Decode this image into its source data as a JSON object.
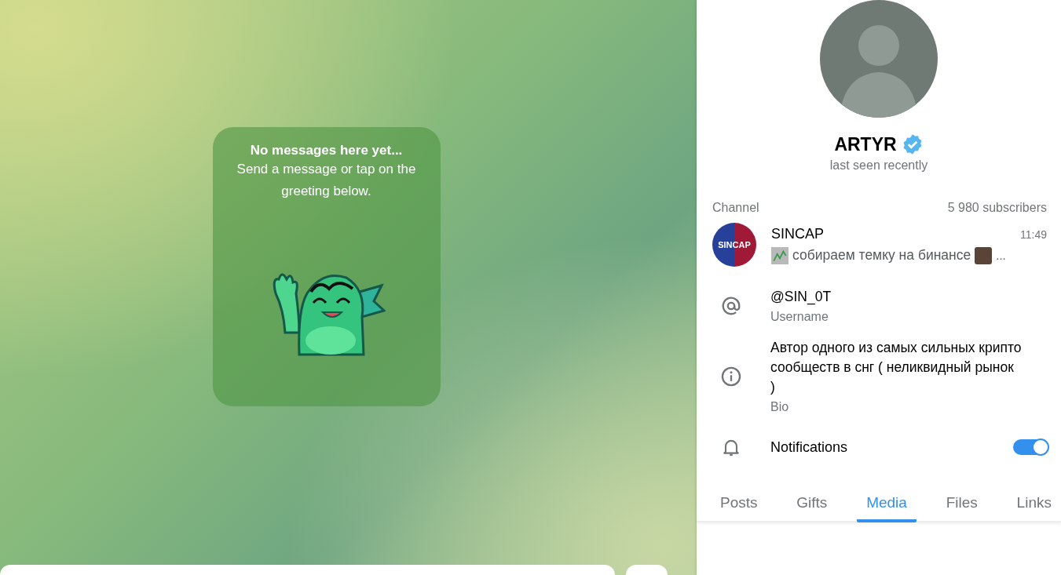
{
  "chat": {
    "empty_title": "No messages here yet...",
    "empty_text": "Send a message or tap on the greeting below."
  },
  "profile": {
    "name": "ARTYR",
    "verified": true,
    "status": "last seen recently"
  },
  "channel": {
    "label": "Channel",
    "subscribers": "5 980 subscribers",
    "name": "SINCAP",
    "logo_left": "SIN",
    "logo_right": "CAP",
    "time": "11:49",
    "preview": "собираем темку на бинансе",
    "more": "..."
  },
  "info": [
    {
      "kind": "username",
      "value": "@SIN_0T",
      "label": "Username"
    },
    {
      "kind": "bio",
      "value": "Автор одного из самых сильных крипто сообществ в снг ( неликвидный рынок )",
      "label": "Bio"
    }
  ],
  "notifications": {
    "label": "Notifications",
    "on": true
  },
  "tabs": [
    {
      "label": "Posts",
      "selected": false
    },
    {
      "label": "Gifts",
      "selected": false
    },
    {
      "label": "Media",
      "selected": true
    },
    {
      "label": "Files",
      "selected": false
    },
    {
      "label": "Links",
      "selected": false
    }
  ]
}
